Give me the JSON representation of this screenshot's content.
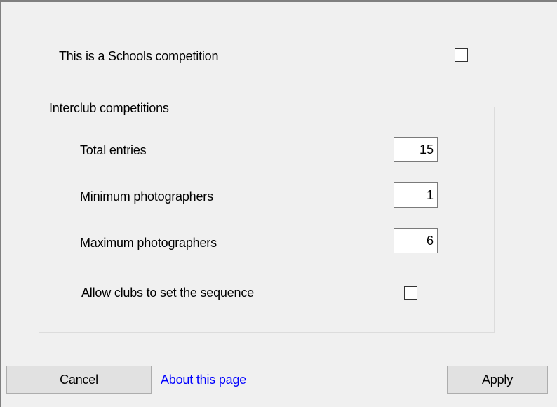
{
  "schools": {
    "label": "This is a Schools competition",
    "checked": false
  },
  "interclub": {
    "legend": "Interclub competitions",
    "total_entries": {
      "label": "Total entries",
      "value": "15"
    },
    "min_photographers": {
      "label": "Minimum photographers",
      "value": "1"
    },
    "max_photographers": {
      "label": "Maximum photographers",
      "value": "6"
    },
    "allow_sequence": {
      "label": "Allow clubs to set the sequence",
      "checked": false
    }
  },
  "footer": {
    "cancel_label": "Cancel",
    "about_link": "About this page",
    "apply_label": "Apply"
  },
  "colors": {
    "background": "#f0f0f0",
    "button_face": "#e1e1e1",
    "link": "#0000ff",
    "group_border": "#dcdcdc"
  }
}
